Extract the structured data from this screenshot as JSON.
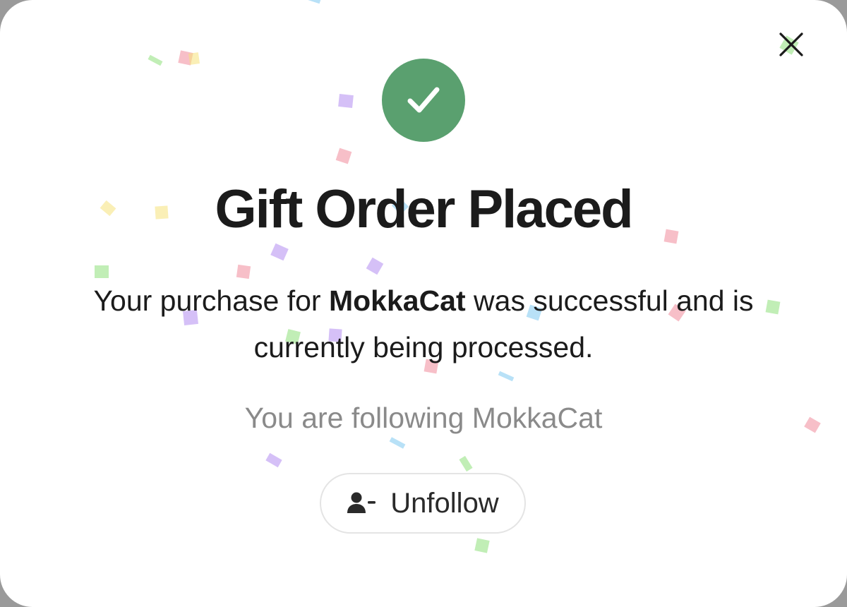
{
  "dialog": {
    "title": "Gift Order Placed",
    "message_prefix": "Your purchase for ",
    "message_item": "MokkaCat",
    "message_suffix": " was successful and is currently being processed.",
    "following_text": "You are following MokkaCat",
    "unfollow_label": "Unfollow"
  },
  "icons": {
    "close": "close-icon",
    "success": "checkmark-icon",
    "unfollow": "user-minus-icon"
  },
  "colors": {
    "success_green": "#5aa06f",
    "title_text": "#1b1b1b",
    "muted_text": "#8a8a8a",
    "button_border": "#e4e4e4"
  }
}
